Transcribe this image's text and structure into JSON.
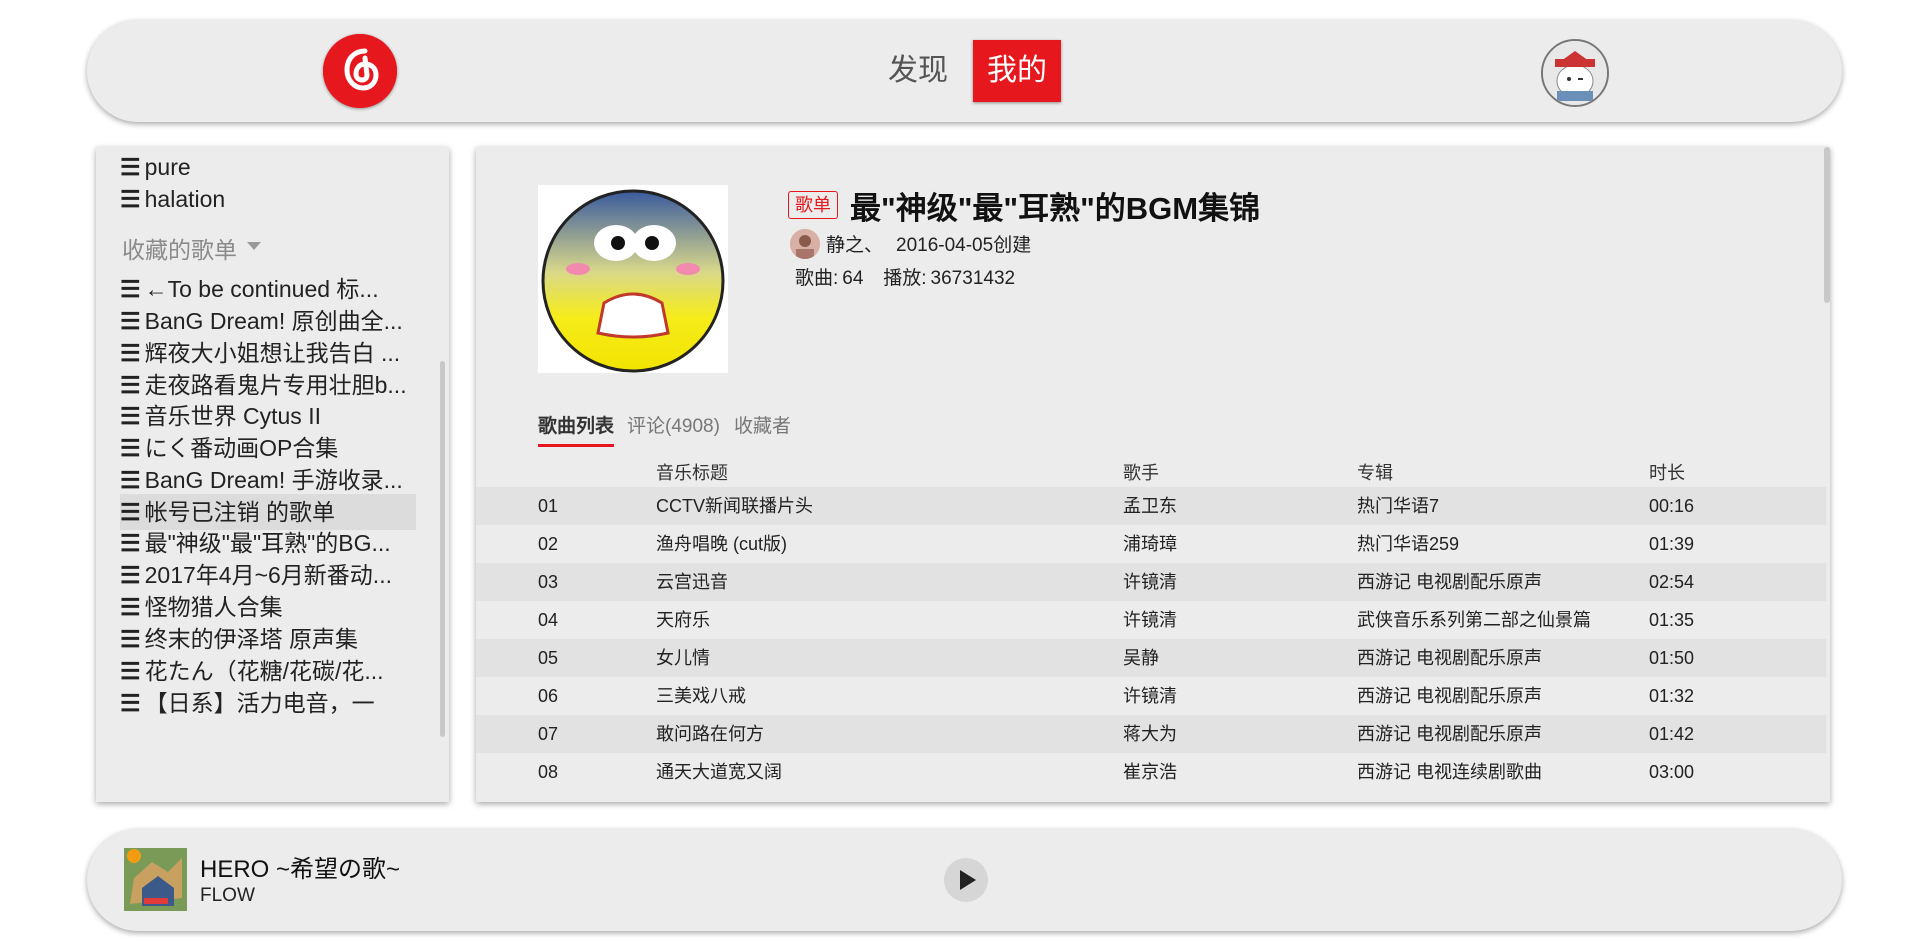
{
  "colors": {
    "accent": "#e6181e",
    "panel": "#ececec",
    "row_shade": "#e2e2e2"
  },
  "header": {
    "logo_icon": "netease-music-logo-icon",
    "tabs": [
      {
        "label": "发现",
        "active": false
      },
      {
        "label": "我的",
        "active": true
      }
    ],
    "avatar_icon": "user-avatar"
  },
  "sidebar": {
    "top_items": [
      "pure",
      "halation"
    ],
    "collected_label": "收藏的歌单",
    "collected_items": [
      "←To be continued 标...",
      "BanG Dream! 原创曲全...",
      "辉夜大小姐想让我告白 ...",
      "走夜路看鬼片专用壮胆b...",
      "音乐世界 Cytus II",
      "にく番动画OP合集",
      "BanG Dream! 手游收录...",
      "帐号已注销 的歌单",
      "最\"神级\"最\"耳熟\"的BG...",
      "2017年4月~6月新番动...",
      "怪物猎人合集",
      "终末的伊泽塔 原声集",
      "花たん（花糖/花碳/花...",
      "【日系】活力电音，一"
    ],
    "active_index": 7
  },
  "playlist": {
    "badge": "歌单",
    "title": "最\"神级\"最\"耳熟\"的BGM集锦",
    "creator": "静之、",
    "created": "2016-04-05创建",
    "songs_label": "歌曲:",
    "songs_count": "64",
    "plays_label": "播放:",
    "plays_count": "36731432",
    "subtabs": [
      "歌曲列表",
      "评论(4908)",
      "收藏者"
    ],
    "columns": {
      "title": "音乐标题",
      "artist": "歌手",
      "album": "专辑",
      "duration": "时长"
    },
    "rows": [
      {
        "no": "01",
        "title": "CCTV新闻联播片头",
        "artist": "孟卫东",
        "album": "热门华语7",
        "duration": "00:16"
      },
      {
        "no": "02",
        "title": "渔舟唱晚 (cut版)",
        "artist": "浦琦璋",
        "album": "热门华语259",
        "duration": "01:39"
      },
      {
        "no": "03",
        "title": "云宫迅音",
        "artist": "许镜清",
        "album": "西游记 电视剧配乐原声",
        "duration": "02:54"
      },
      {
        "no": "04",
        "title": "天府乐",
        "artist": "许镜清",
        "album": "武侠音乐系列第二部之仙景篇",
        "duration": "01:35"
      },
      {
        "no": "05",
        "title": "女儿情",
        "artist": "吴静",
        "album": "西游记 电视剧配乐原声",
        "duration": "01:50"
      },
      {
        "no": "06",
        "title": "三美戏八戒",
        "artist": "许镜清",
        "album": "西游记 电视剧配乐原声",
        "duration": "01:32"
      },
      {
        "no": "07",
        "title": "敢问路在何方",
        "artist": "蒋大为",
        "album": "西游记 电视剧配乐原声",
        "duration": "01:42"
      },
      {
        "no": "08",
        "title": "通天大道宽又阔",
        "artist": "崔京浩",
        "album": "西游记 电视连续剧歌曲",
        "duration": "03:00"
      }
    ]
  },
  "player": {
    "title": "HERO ~希望の歌~",
    "artist": "FLOW",
    "play_icon": "play-icon"
  }
}
